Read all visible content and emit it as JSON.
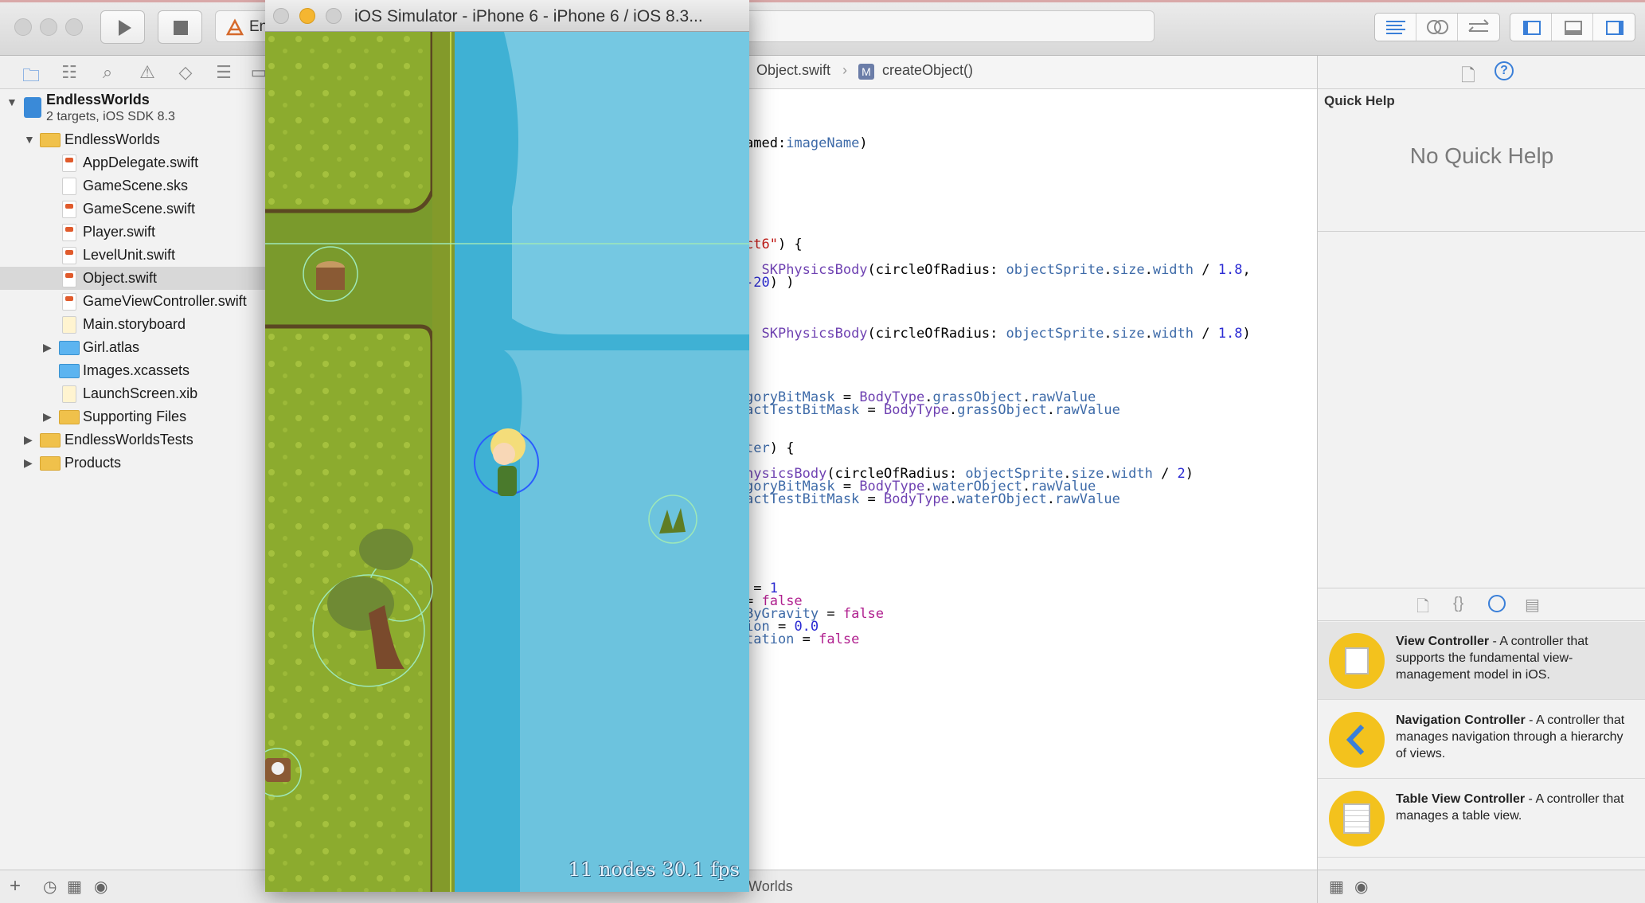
{
  "toolbar": {
    "scheme_label": "En",
    "colors": {
      "accent": "#3a7fd8"
    }
  },
  "navigator": {
    "project": {
      "name": "EndlessWorlds",
      "subtitle": "2 targets, iOS SDK 8.3"
    },
    "items": [
      {
        "label": "EndlessWorlds",
        "kind": "folder"
      },
      {
        "label": "AppDelegate.swift",
        "kind": "swift"
      },
      {
        "label": "GameScene.sks",
        "kind": "file"
      },
      {
        "label": "GameScene.swift",
        "kind": "swift"
      },
      {
        "label": "Player.swift",
        "kind": "swift"
      },
      {
        "label": "LevelUnit.swift",
        "kind": "swift"
      },
      {
        "label": "Object.swift",
        "kind": "swift",
        "selected": true
      },
      {
        "label": "GameViewController.swift",
        "kind": "swift"
      },
      {
        "label": "Main.storyboard",
        "kind": "storyboard"
      },
      {
        "label": "Girl.atlas",
        "kind": "folder-blue"
      },
      {
        "label": "Images.xcassets",
        "kind": "assets"
      },
      {
        "label": "LaunchScreen.xib",
        "kind": "xib"
      },
      {
        "label": "Supporting Files",
        "kind": "folder"
      },
      {
        "label": "EndlessWorldsTests",
        "kind": "folder"
      },
      {
        "label": "Products",
        "kind": "folder"
      }
    ]
  },
  "editor": {
    "jumpbar": {
      "file": "Object.swift",
      "method": "createObject()"
    },
    "bottom_label": "EndlessWorlds"
  },
  "quick_help": {
    "title": "Quick Help",
    "empty": "No Quick Help"
  },
  "library": [
    {
      "name": "View Controller",
      "desc": " - A controller that supports the fundamental view-management model in iOS."
    },
    {
      "name": "Navigation Controller",
      "desc": " - A controller that manages navigation through a hierarchy of views."
    },
    {
      "name": "Table View Controller",
      "desc": " - A controller that manages a table view."
    }
  ],
  "simulator": {
    "title": "iOS Simulator - iPhone 6 - iPhone 6 / iOS 8.3...",
    "stats": "11 nodes  30.1 fps"
  }
}
